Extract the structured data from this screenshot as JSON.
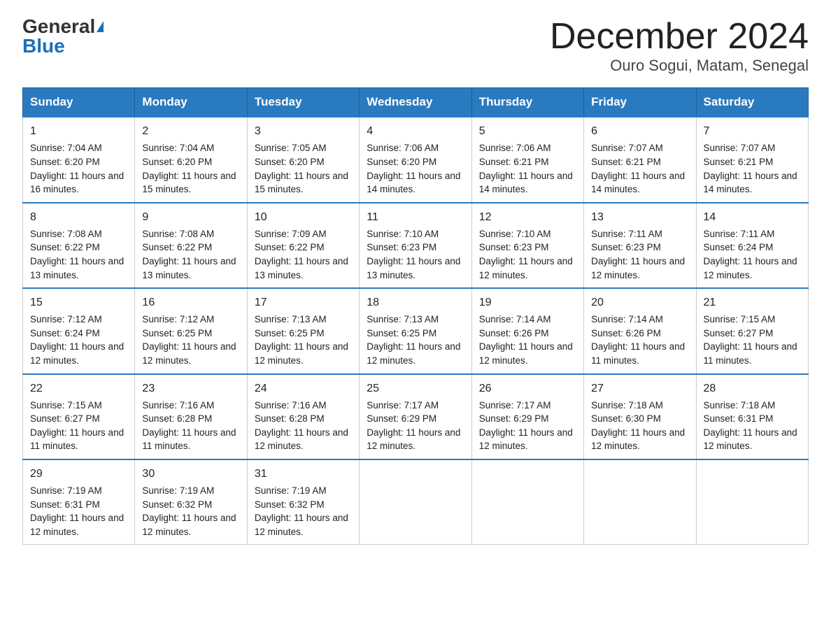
{
  "logo": {
    "general": "General",
    "blue": "Blue"
  },
  "title": "December 2024",
  "subtitle": "Ouro Sogui, Matam, Senegal",
  "days_of_week": [
    "Sunday",
    "Monday",
    "Tuesday",
    "Wednesday",
    "Thursday",
    "Friday",
    "Saturday"
  ],
  "weeks": [
    [
      {
        "day": "1",
        "sunrise": "7:04 AM",
        "sunset": "6:20 PM",
        "daylight": "11 hours and 16 minutes."
      },
      {
        "day": "2",
        "sunrise": "7:04 AM",
        "sunset": "6:20 PM",
        "daylight": "11 hours and 15 minutes."
      },
      {
        "day": "3",
        "sunrise": "7:05 AM",
        "sunset": "6:20 PM",
        "daylight": "11 hours and 15 minutes."
      },
      {
        "day": "4",
        "sunrise": "7:06 AM",
        "sunset": "6:20 PM",
        "daylight": "11 hours and 14 minutes."
      },
      {
        "day": "5",
        "sunrise": "7:06 AM",
        "sunset": "6:21 PM",
        "daylight": "11 hours and 14 minutes."
      },
      {
        "day": "6",
        "sunrise": "7:07 AM",
        "sunset": "6:21 PM",
        "daylight": "11 hours and 14 minutes."
      },
      {
        "day": "7",
        "sunrise": "7:07 AM",
        "sunset": "6:21 PM",
        "daylight": "11 hours and 14 minutes."
      }
    ],
    [
      {
        "day": "8",
        "sunrise": "7:08 AM",
        "sunset": "6:22 PM",
        "daylight": "11 hours and 13 minutes."
      },
      {
        "day": "9",
        "sunrise": "7:08 AM",
        "sunset": "6:22 PM",
        "daylight": "11 hours and 13 minutes."
      },
      {
        "day": "10",
        "sunrise": "7:09 AM",
        "sunset": "6:22 PM",
        "daylight": "11 hours and 13 minutes."
      },
      {
        "day": "11",
        "sunrise": "7:10 AM",
        "sunset": "6:23 PM",
        "daylight": "11 hours and 13 minutes."
      },
      {
        "day": "12",
        "sunrise": "7:10 AM",
        "sunset": "6:23 PM",
        "daylight": "11 hours and 12 minutes."
      },
      {
        "day": "13",
        "sunrise": "7:11 AM",
        "sunset": "6:23 PM",
        "daylight": "11 hours and 12 minutes."
      },
      {
        "day": "14",
        "sunrise": "7:11 AM",
        "sunset": "6:24 PM",
        "daylight": "11 hours and 12 minutes."
      }
    ],
    [
      {
        "day": "15",
        "sunrise": "7:12 AM",
        "sunset": "6:24 PM",
        "daylight": "11 hours and 12 minutes."
      },
      {
        "day": "16",
        "sunrise": "7:12 AM",
        "sunset": "6:25 PM",
        "daylight": "11 hours and 12 minutes."
      },
      {
        "day": "17",
        "sunrise": "7:13 AM",
        "sunset": "6:25 PM",
        "daylight": "11 hours and 12 minutes."
      },
      {
        "day": "18",
        "sunrise": "7:13 AM",
        "sunset": "6:25 PM",
        "daylight": "11 hours and 12 minutes."
      },
      {
        "day": "19",
        "sunrise": "7:14 AM",
        "sunset": "6:26 PM",
        "daylight": "11 hours and 12 minutes."
      },
      {
        "day": "20",
        "sunrise": "7:14 AM",
        "sunset": "6:26 PM",
        "daylight": "11 hours and 11 minutes."
      },
      {
        "day": "21",
        "sunrise": "7:15 AM",
        "sunset": "6:27 PM",
        "daylight": "11 hours and 11 minutes."
      }
    ],
    [
      {
        "day": "22",
        "sunrise": "7:15 AM",
        "sunset": "6:27 PM",
        "daylight": "11 hours and 11 minutes."
      },
      {
        "day": "23",
        "sunrise": "7:16 AM",
        "sunset": "6:28 PM",
        "daylight": "11 hours and 11 minutes."
      },
      {
        "day": "24",
        "sunrise": "7:16 AM",
        "sunset": "6:28 PM",
        "daylight": "11 hours and 12 minutes."
      },
      {
        "day": "25",
        "sunrise": "7:17 AM",
        "sunset": "6:29 PM",
        "daylight": "11 hours and 12 minutes."
      },
      {
        "day": "26",
        "sunrise": "7:17 AM",
        "sunset": "6:29 PM",
        "daylight": "11 hours and 12 minutes."
      },
      {
        "day": "27",
        "sunrise": "7:18 AM",
        "sunset": "6:30 PM",
        "daylight": "11 hours and 12 minutes."
      },
      {
        "day": "28",
        "sunrise": "7:18 AM",
        "sunset": "6:31 PM",
        "daylight": "11 hours and 12 minutes."
      }
    ],
    [
      {
        "day": "29",
        "sunrise": "7:19 AM",
        "sunset": "6:31 PM",
        "daylight": "11 hours and 12 minutes."
      },
      {
        "day": "30",
        "sunrise": "7:19 AM",
        "sunset": "6:32 PM",
        "daylight": "11 hours and 12 minutes."
      },
      {
        "day": "31",
        "sunrise": "7:19 AM",
        "sunset": "6:32 PM",
        "daylight": "11 hours and 12 minutes."
      },
      null,
      null,
      null,
      null
    ]
  ]
}
